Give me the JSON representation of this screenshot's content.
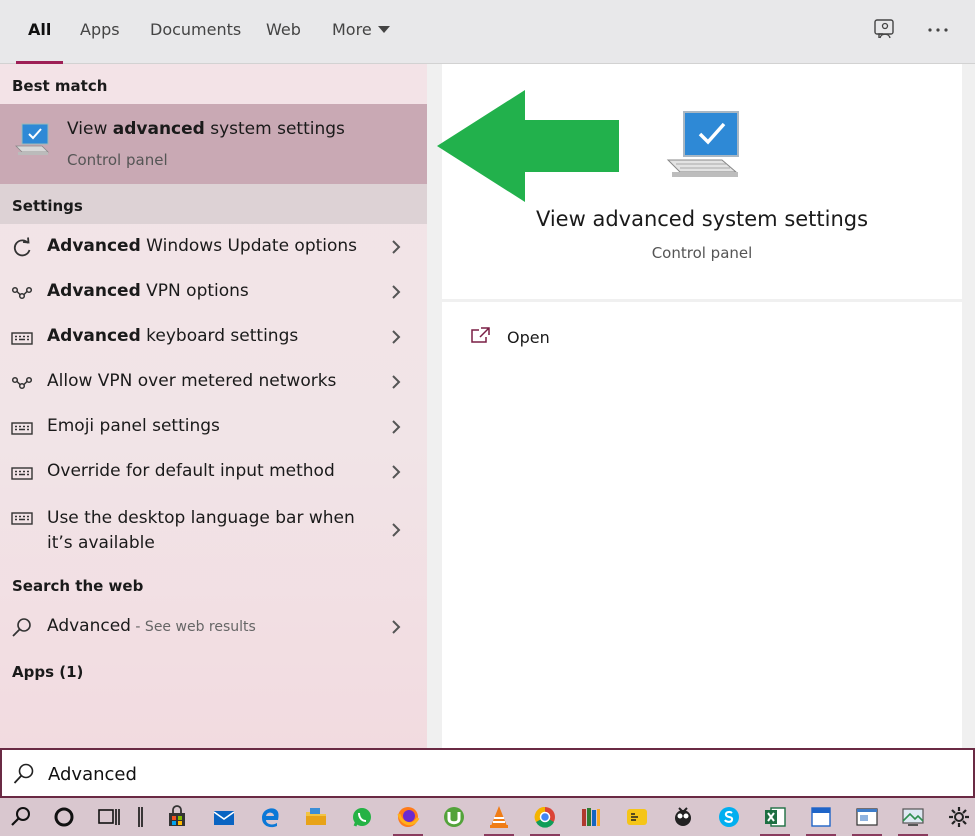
{
  "tabs": [
    {
      "label": "All"
    },
    {
      "label": "Apps"
    },
    {
      "label": "Documents"
    },
    {
      "label": "Web"
    },
    {
      "label": "More"
    }
  ],
  "headers": {
    "best_match": "Best match",
    "settings": "Settings",
    "search_web": "Search the web",
    "apps": "Apps (1)"
  },
  "best_match": {
    "title_pre": "View ",
    "title_bold": "advanced",
    "title_post": " system settings",
    "subtitle": "Control panel"
  },
  "settings_items": [
    {
      "bold": "Advanced",
      "rest": " Windows Update options",
      "icon": "refresh-icon"
    },
    {
      "bold": "Advanced",
      "rest": " VPN options",
      "icon": "vpn-icon"
    },
    {
      "bold": "Advanced",
      "rest": " keyboard settings",
      "icon": "keyboard-icon"
    },
    {
      "bold": "",
      "rest": "Allow VPN over metered networks",
      "icon": "vpn-icon"
    },
    {
      "bold": "",
      "rest": "Emoji panel settings",
      "icon": "keyboard-icon"
    },
    {
      "bold": "",
      "rest": "Override for default input method",
      "icon": "keyboard-icon"
    },
    {
      "bold": "",
      "rest": "Use the desktop language bar when",
      "rest2": "it’s available",
      "icon": "keyboard-icon"
    }
  ],
  "web_result": {
    "query": "Advanced",
    "suffix": " - See web results"
  },
  "detail": {
    "title": "View advanced system settings",
    "subtitle": "Control panel",
    "action_open": "Open"
  },
  "search": {
    "value": "Advanced"
  },
  "colors": {
    "accent": "#9e1f56",
    "best_match_bg": "#c9a9b4",
    "arrow": "#22b14c"
  }
}
